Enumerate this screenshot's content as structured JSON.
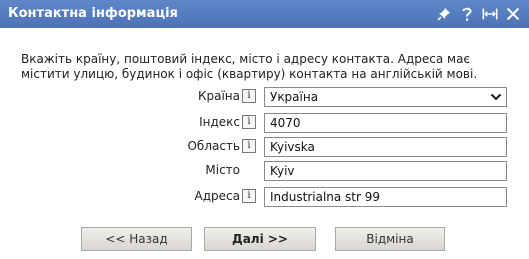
{
  "window": {
    "title": "Контактна інформація",
    "icons": [
      "pin-icon",
      "help-icon",
      "resize-icon",
      "close-icon"
    ]
  },
  "intro_text": "Вкажіть країну, поштовий індекс, місто і адресу контакта. Адреса має містити улицю, будинок і офіс (квартиру) контакта на англійській мові.",
  "form": {
    "country": {
      "label": "Країна",
      "value": "Україна"
    },
    "index": {
      "label": "Індекс",
      "value": "4070"
    },
    "region": {
      "label": "Область",
      "value": "Kyivska"
    },
    "city": {
      "label": "Місто",
      "value": "Kyiv"
    },
    "address": {
      "label": "Адреса",
      "value": "Industrialna str 99"
    },
    "info_glyph": "i"
  },
  "buttons": {
    "back": "<< Назад",
    "next": "Далі >>",
    "cancel": "Відміна"
  },
  "colors": {
    "titlebar": "#5679be",
    "button_bg": "#e4e2dc"
  }
}
